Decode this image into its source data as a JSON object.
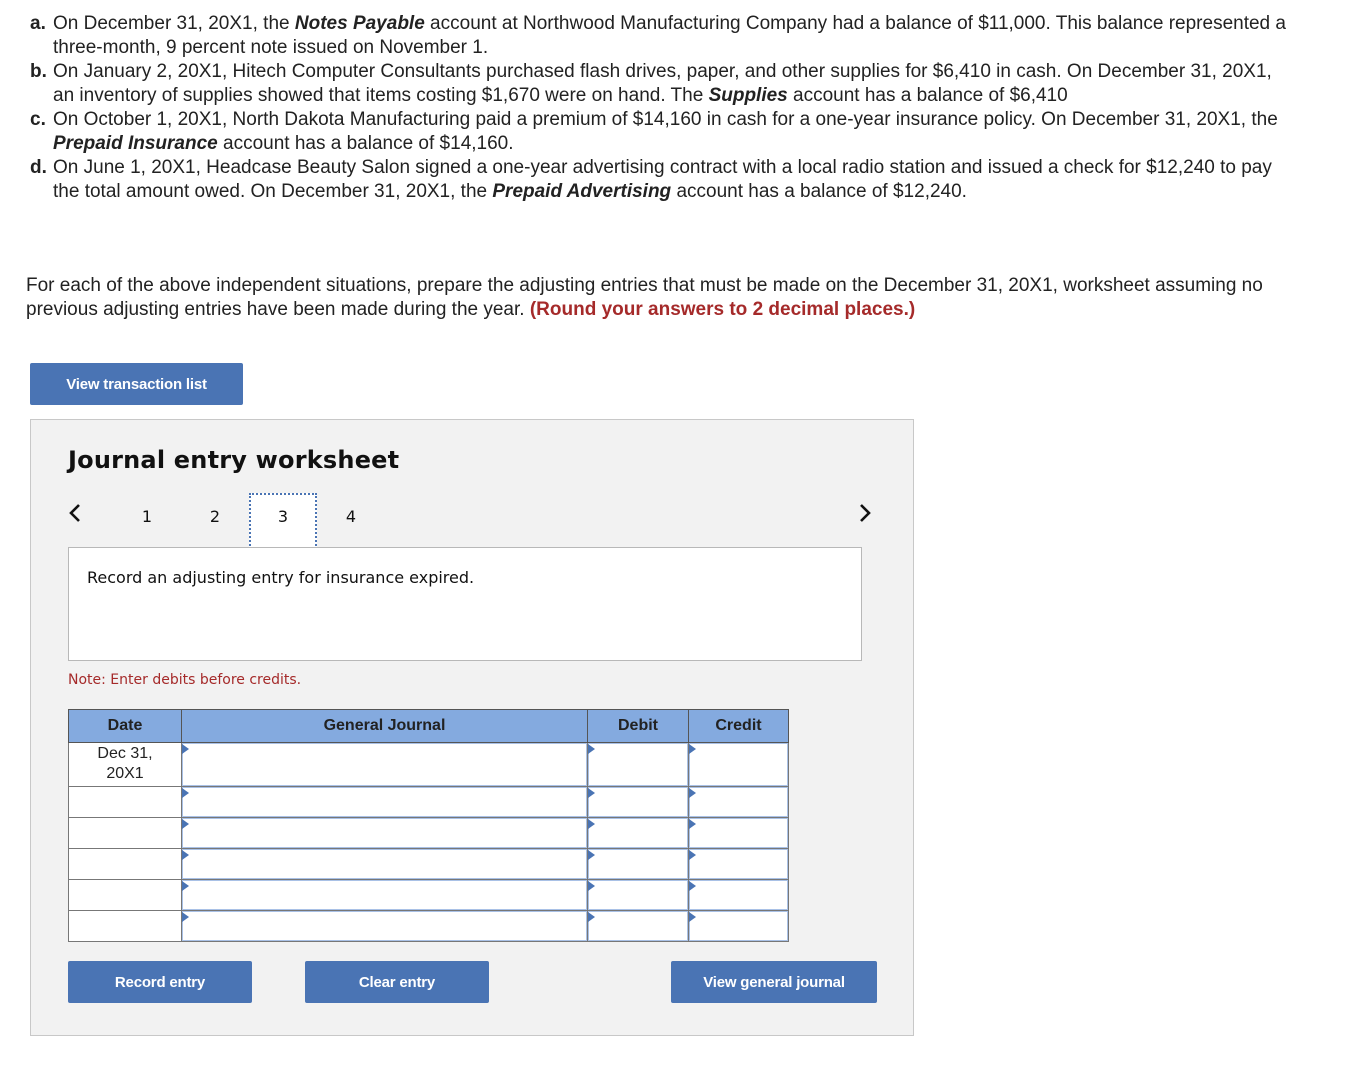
{
  "problems": [
    {
      "letter": "a.",
      "segments": [
        {
          "text": "On December 31, 20X1, the ",
          "bold": false
        },
        {
          "text": "Notes Payable",
          "bold": true
        },
        {
          "text": " account at Northwood Manufacturing Company had a balance of $11,000. This balance represented a three-month, 9 percent note issued on November 1.",
          "bold": false
        }
      ]
    },
    {
      "letter": "b.",
      "segments": [
        {
          "text": "On January 2, 20X1, Hitech Computer Consultants purchased flash drives, paper, and other supplies for $6,410 in cash. On December 31, 20X1, an inventory of supplies showed that items costing $1,670 were on hand. The ",
          "bold": false
        },
        {
          "text": "Supplies",
          "bold": true
        },
        {
          "text": " account has a balance of $6,410",
          "bold": false
        }
      ]
    },
    {
      "letter": "c.",
      "segments": [
        {
          "text": "On October 1, 20X1, North Dakota Manufacturing paid a premium of $14,160 in cash for a one-year insurance policy. On December 31, 20X1, the ",
          "bold": false
        },
        {
          "text": "Prepaid Insurance",
          "bold": true
        },
        {
          "text": " account has a balance of $14,160.",
          "bold": false
        }
      ]
    },
    {
      "letter": "d.",
      "segments": [
        {
          "text": "On June 1, 20X1, Headcase Beauty Salon signed a one-year advertising contract with a local radio station and issued a check for $12,240 to pay the total amount owed. On December 31, 20X1, the ",
          "bold": false
        },
        {
          "text": "Prepaid Advertising",
          "bold": true
        },
        {
          "text": " account has a balance of $12,240.",
          "bold": false
        }
      ]
    }
  ],
  "instruction": {
    "text": "For each of the above independent situations, prepare the adjusting entries that must be made on the December 31, 20X1, worksheet assuming no previous adjusting entries have been made during the year. ",
    "emphasis": "(Round your answers to 2 decimal places.)"
  },
  "buttons": {
    "view_transaction_list": "View transaction list",
    "record_entry": "Record entry",
    "clear_entry": "Clear entry",
    "view_general_journal": "View general journal"
  },
  "worksheet": {
    "title": "Journal entry worksheet",
    "nav": {
      "prev_icon": "‹",
      "next_icon": "›",
      "pages": [
        "1",
        "2",
        "3",
        "4"
      ],
      "current_page": "3"
    },
    "prompt": "Record an adjusting entry for insurance expired.",
    "note": "Note: Enter debits before credits.",
    "table": {
      "headers": {
        "date": "Date",
        "general_journal": "General Journal",
        "debit": "Debit",
        "credit": "Credit"
      },
      "rows": [
        {
          "date": "Dec 31, 20X1",
          "account": "",
          "debit": "",
          "credit": ""
        },
        {
          "date": "",
          "account": "",
          "debit": "",
          "credit": ""
        },
        {
          "date": "",
          "account": "",
          "debit": "",
          "credit": ""
        },
        {
          "date": "",
          "account": "",
          "debit": "",
          "credit": ""
        },
        {
          "date": "",
          "account": "",
          "debit": "",
          "credit": ""
        },
        {
          "date": "",
          "account": "",
          "debit": "",
          "credit": ""
        }
      ]
    }
  },
  "colors": {
    "button_blue": "#4a74b4",
    "header_blue": "#84aadf",
    "emphasis_red": "#a52a2a",
    "panel_gray": "#f2f2f2"
  }
}
